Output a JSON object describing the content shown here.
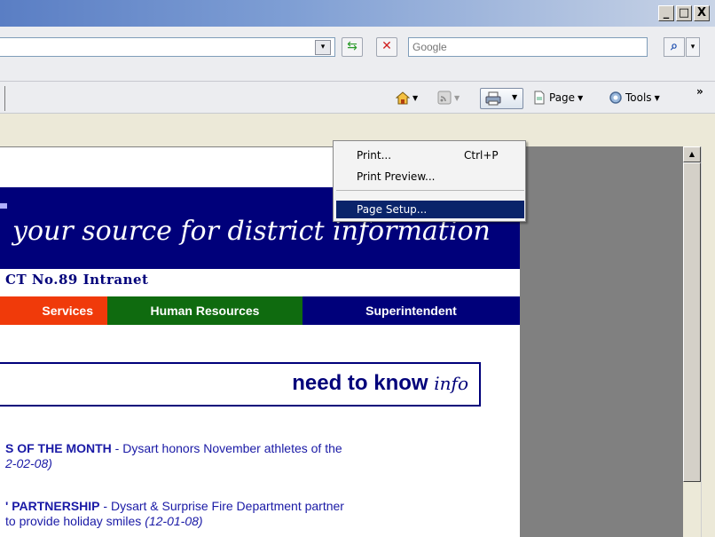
{
  "window": {
    "min_label": "_",
    "max_label": "□",
    "close_label": "X"
  },
  "addressbar": {
    "refresh_icon": "refresh-icon",
    "stop_icon": "stop-icon",
    "search_placeholder": "Google",
    "search_go_icon": "search-icon",
    "dropdown_glyph": "▾"
  },
  "commandbar": {
    "page_label": "Page",
    "tools_label": "Tools",
    "overflow_label": "»"
  },
  "print_menu": {
    "items": [
      {
        "label": "Print...",
        "shortcut": "Ctrl+P"
      },
      {
        "label": "Print Preview...",
        "shortcut": ""
      },
      {
        "label": "Page Setup...",
        "shortcut": ""
      }
    ]
  },
  "page": {
    "tagline": "your source for district information",
    "intranet_title": "CT No.89 Intranet",
    "nav": [
      {
        "label": "Services",
        "color": "#f03a0a"
      },
      {
        "label": "Human Resources",
        "color": "#0f6b0f"
      },
      {
        "label": "Superintendent",
        "color": "#00007a"
      }
    ],
    "need_to_know": "need to know",
    "need_to_know_suffix": "info",
    "news": [
      {
        "title": "S OF THE MONTH",
        "text": " - Dysart honors November athletes of the",
        "date_line": "2-02-08)"
      },
      {
        "title": "' PARTNERSHIP",
        "text": " - Dysart & Surprise Fire Department partner",
        "line2": "to provide holiday smiles ",
        "date": "(12-01-08)"
      }
    ]
  },
  "colors": {
    "banner": "#00007a",
    "menu_highlight": "#0a246a"
  }
}
